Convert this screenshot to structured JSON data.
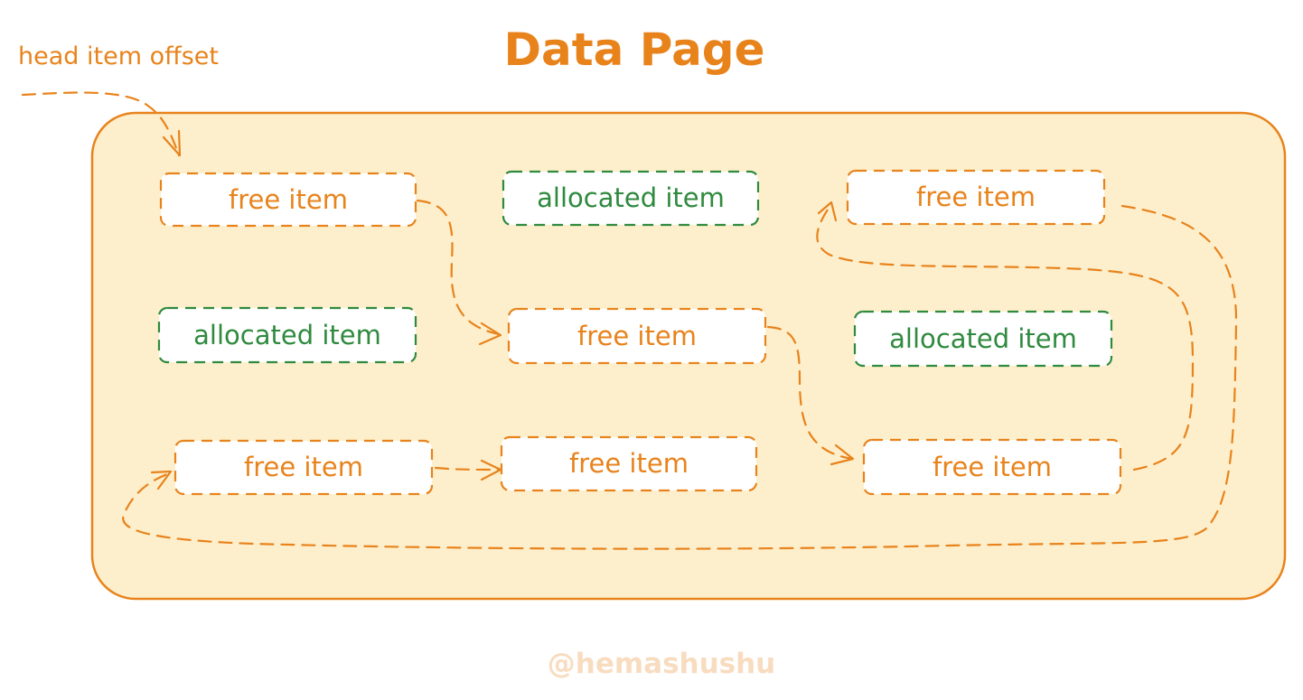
{
  "title": "Data Page",
  "head_label": "head item offset",
  "watermark": "@hemashushu",
  "colors": {
    "free": "#e8831c",
    "allocated": "#2f8a3e",
    "page_fill": "#fdefcc",
    "page_border": "#e8831c",
    "watermark": "#f8dcc0"
  },
  "items": [
    {
      "id": "f1",
      "type": "free",
      "label": "free item"
    },
    {
      "id": "a1",
      "type": "allocated",
      "label": "allocated item"
    },
    {
      "id": "f2",
      "type": "free",
      "label": "free item"
    },
    {
      "id": "a2",
      "type": "allocated",
      "label": "allocated item"
    },
    {
      "id": "f3",
      "type": "free",
      "label": "free item"
    },
    {
      "id": "a3",
      "type": "allocated",
      "label": "allocated item"
    },
    {
      "id": "f4",
      "type": "free",
      "label": "free item"
    },
    {
      "id": "f5",
      "type": "free",
      "label": "free item"
    },
    {
      "id": "f6",
      "type": "free",
      "label": "free item"
    }
  ],
  "links": [
    {
      "from": "head",
      "to": "f1"
    },
    {
      "from": "f1",
      "to": "f3"
    },
    {
      "from": "f3",
      "to": "f6"
    },
    {
      "from": "f6",
      "to": "f2"
    },
    {
      "from": "f2",
      "to": "f4"
    },
    {
      "from": "f4",
      "to": "f5"
    }
  ]
}
